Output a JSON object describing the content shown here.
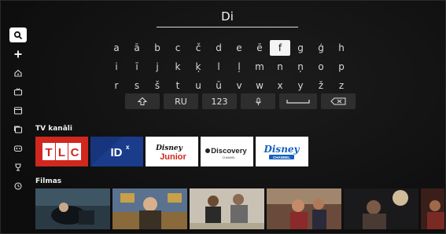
{
  "search": {
    "query": "Di"
  },
  "sidebar": {
    "items": [
      {
        "icon": "search-icon",
        "active": true
      },
      {
        "icon": "plus-icon",
        "active": false
      },
      {
        "icon": "home-icon",
        "active": false
      },
      {
        "icon": "tv-icon",
        "active": false
      },
      {
        "icon": "film-icon",
        "active": false
      },
      {
        "icon": "recordings-icon",
        "active": false
      },
      {
        "icon": "gamepad-icon",
        "active": false
      },
      {
        "icon": "trophy-icon",
        "active": false
      },
      {
        "icon": "history-icon",
        "active": false
      }
    ]
  },
  "keyboard": {
    "rows": [
      [
        "a",
        "ā",
        "b",
        "c",
        "č",
        "d",
        "e",
        "ē",
        "f",
        "g",
        "ģ",
        "h"
      ],
      [
        "i",
        "ī",
        "j",
        "k",
        "ķ",
        "l",
        "ļ",
        "m",
        "n",
        "ņ",
        "o",
        "p"
      ],
      [
        "r",
        "s",
        "š",
        "t",
        "u",
        "ū",
        "v",
        "w",
        "x",
        "y",
        "ž",
        "z"
      ]
    ],
    "selected": "f",
    "language_label": "RU",
    "numbers_label": "123"
  },
  "channels_section": {
    "title": "TV kanāli",
    "channels": [
      {
        "name": "TLC"
      },
      {
        "name": "IDX"
      },
      {
        "name": "Disney Junior",
        "line1": "Disney",
        "line2": "Junior"
      },
      {
        "name": "Discovery",
        "line1": "Discovery",
        "line2": "CHANNEL"
      },
      {
        "name": "Disney Channel",
        "line1": "Disney",
        "line2": "CHANNEL"
      }
    ]
  },
  "movies_section": {
    "title": "Filmas",
    "count": 6
  },
  "colors": {
    "background": "#141414",
    "tlc_red": "#d0271f",
    "idx_blue": "#1b3a86",
    "disney_blue": "#1560bd",
    "selected_key": "#f4f4f4"
  }
}
